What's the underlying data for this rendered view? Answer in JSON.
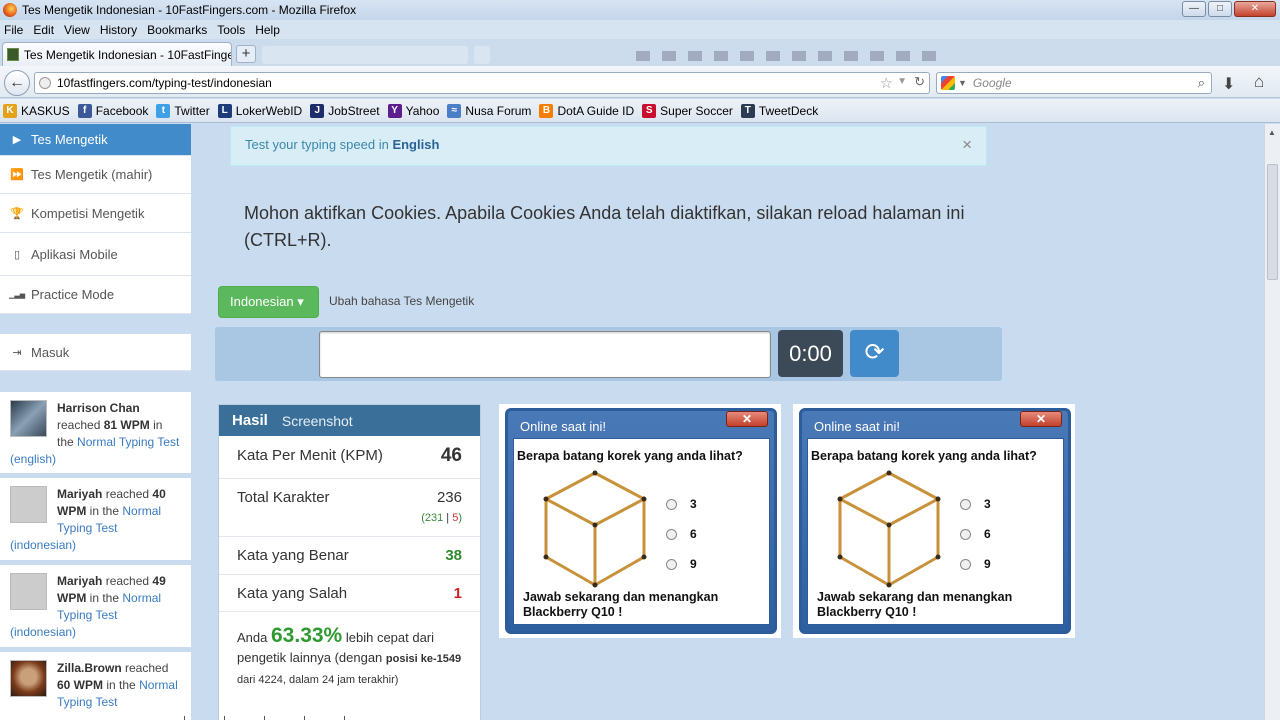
{
  "window": {
    "title": "Tes Mengetik Indonesian - 10FastFingers.com - Mozilla Firefox",
    "minimize": "—",
    "maximize": "□",
    "close": "✕"
  },
  "menu": [
    "File",
    "Edit",
    "View",
    "History",
    "Bookmarks",
    "Tools",
    "Help"
  ],
  "tab": {
    "label": "Tes Mengetik Indonesian - 10FastFingers...",
    "close": "✕",
    "new_tab": "+"
  },
  "nav": {
    "url": "10fastfingers.com/typing-test/indonesian",
    "search_placeholder": "Google"
  },
  "bookmarks": [
    {
      "label": "KASKUS",
      "icon": "kaskus-icon",
      "color": "#e3a21a",
      "glyph": "K"
    },
    {
      "label": "Facebook",
      "icon": "facebook-icon",
      "color": "#3b5998",
      "glyph": "f"
    },
    {
      "label": "Twitter",
      "icon": "twitter-icon",
      "color": "#3fa0e8",
      "glyph": "t"
    },
    {
      "label": "LokerWebID",
      "icon": "lokerweb-icon",
      "color": "#1c3d7a",
      "glyph": "L"
    },
    {
      "label": "JobStreet",
      "icon": "jobstreet-icon",
      "color": "#1d2d6b",
      "glyph": "J"
    },
    {
      "label": "Yahoo",
      "icon": "yahoo-icon",
      "color": "#5c1d8e",
      "glyph": "Y"
    },
    {
      "label": "Nusa Forum",
      "icon": "nusaforum-icon",
      "color": "#4a7fc8",
      "glyph": "≈"
    },
    {
      "label": "DotA Guide ID",
      "icon": "blogger-icon",
      "color": "#f57d00",
      "glyph": "B"
    },
    {
      "label": "Super Soccer",
      "icon": "supersoccer-icon",
      "color": "#c8102e",
      "glyph": "S"
    },
    {
      "label": "TweetDeck",
      "icon": "tweetdeck-icon",
      "color": "#2a3b52",
      "glyph": "T"
    }
  ],
  "sidebar": {
    "items": [
      {
        "label": "Tes Mengetik",
        "icon": "▶",
        "active": true
      },
      {
        "label": "Tes Mengetik (mahir)",
        "icon": "⏩"
      },
      {
        "label": "Kompetisi Mengetik",
        "icon": "🏆"
      },
      {
        "label": "Aplikasi Mobile",
        "icon": "▯"
      },
      {
        "label": "Practice Mode",
        "icon": "▁▃▅"
      }
    ],
    "login": {
      "label": "Masuk",
      "icon": "⇥"
    },
    "activity": [
      {
        "name": "Harrison Chan",
        "verb": "reached",
        "wpm": "81 WPM",
        "mid": "in the",
        "test": "Normal Typing Test (english)"
      },
      {
        "name": "Mariyah",
        "verb": "reached",
        "wpm": "40 WPM",
        "mid": "in the",
        "test": "Normal Typing Test (indonesian)"
      },
      {
        "name": "Mariyah",
        "verb": "reached",
        "wpm": "49 WPM",
        "mid": "in the",
        "test": "Normal Typing Test (indonesian)"
      },
      {
        "name": "Zilla.Brown",
        "verb": "reached",
        "wpm": "60 WPM",
        "mid": "in the",
        "test": "Normal Typing Test"
      }
    ]
  },
  "alert": {
    "text": "Test your typing speed in",
    "lang": "English",
    "close": "×"
  },
  "cookie_message": "Mohon aktifkan Cookies. Apabila Cookies Anda telah diaktifkan, silakan reload halaman ini (CTRL+R).",
  "language": {
    "button": "Indonesian",
    "caret": "▾",
    "hint": "Ubah bahasa Tes Mengetik"
  },
  "typing": {
    "timer": "0:00",
    "reload_icon": "⟳"
  },
  "results": {
    "tab_active": "Hasil",
    "tab_other": "Screenshot",
    "rows": [
      {
        "label": "Kata Per Menit (KPM)",
        "value": "46"
      },
      {
        "label": "Total Karakter",
        "value": "236",
        "sub_open": "(231",
        "sub_sep": " | ",
        "sub_bad": "5",
        "sub_close": ")"
      },
      {
        "label": "Kata yang Benar",
        "value": "38",
        "color": "#2f8a2f"
      },
      {
        "label": "Kata yang Salah",
        "value": "1",
        "color": "#cc2222"
      }
    ],
    "percent_pre": "Anda",
    "percent": "63.33%",
    "percent_post": "lebih cepat dari pengetik lainnya (dengan",
    "rank_label": "posisi ke-1549",
    "rank_post": "dari 4224, dalam 24 jam terakhir)"
  },
  "ads": [
    {
      "title": "Online saat ini!",
      "close": "✕",
      "question": "Berapa batang korek yang anda lihat?",
      "options": [
        "3",
        "6",
        "9"
      ],
      "cta": "Jawab sekarang dan menangkan Blackberry Q10 !"
    },
    {
      "title": "Online saat ini!",
      "close": "✕",
      "question": "Berapa batang korek yang anda lihat?",
      "options": [
        "3",
        "6",
        "9"
      ],
      "cta": "Jawab sekarang dan menangkan Blackberry Q10 !"
    }
  ]
}
